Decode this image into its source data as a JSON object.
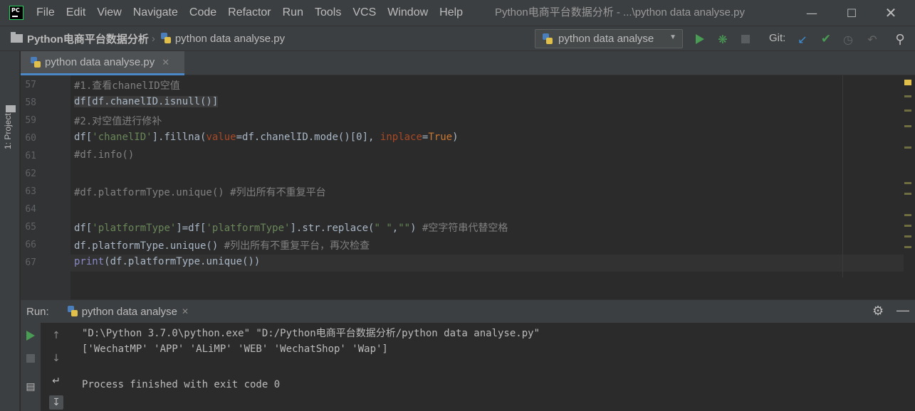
{
  "app": {
    "logo_text": "PC"
  },
  "menu": [
    "File",
    "Edit",
    "View",
    "Navigate",
    "Code",
    "Refactor",
    "Run",
    "Tools",
    "VCS",
    "Window",
    "Help"
  ],
  "window_title": "Python电商平台数据分析 - ...\\python data analyse.py",
  "breadcrumb": {
    "project": "Python电商平台数据分析",
    "file": "python data analyse.py"
  },
  "run_config": {
    "selected": "python data analyse"
  },
  "git_label": "Git:",
  "left_tab": "1: Project",
  "editor_tab": {
    "label": "python data analyse.py"
  },
  "editor": {
    "lines": [
      {
        "n": "57",
        "segs": [
          [
            "cm",
            "#1.查看chanelID空值"
          ]
        ]
      },
      {
        "n": "58",
        "segs": [
          [
            "hl",
            "df[df.chanelID.isnull()]"
          ]
        ]
      },
      {
        "n": "59",
        "segs": [
          [
            "cm",
            "#2.对空值进行修补"
          ]
        ]
      },
      {
        "n": "60",
        "segs": [
          [
            "t",
            "df["
          ],
          [
            "str",
            "'chanelID'"
          ],
          [
            "t",
            "].fillna("
          ],
          [
            "prm",
            "value"
          ],
          [
            "t",
            "=df.chanelID.mode()[0], "
          ],
          [
            "prm",
            "inplace"
          ],
          [
            "t",
            "="
          ],
          [
            "kw",
            "True"
          ],
          [
            "t",
            ")"
          ]
        ]
      },
      {
        "n": "61",
        "segs": [
          [
            "cm",
            "#df.info()"
          ]
        ]
      },
      {
        "n": "62",
        "segs": []
      },
      {
        "n": "63",
        "segs": [
          [
            "cm",
            "#df.platformType.unique() #列出所有不重复平台"
          ]
        ]
      },
      {
        "n": "64",
        "segs": []
      },
      {
        "n": "65",
        "segs": [
          [
            "t",
            "df["
          ],
          [
            "str",
            "'platformType'"
          ],
          [
            "t",
            "]=df["
          ],
          [
            "str",
            "'platformType'"
          ],
          [
            "t",
            "].str.replace("
          ],
          [
            "str",
            "\" \""
          ],
          [
            "t",
            ","
          ],
          [
            "str",
            "\"\""
          ],
          [
            "t",
            ") "
          ],
          [
            "cm",
            "#空字符串代替空格"
          ]
        ]
      },
      {
        "n": "66",
        "segs": [
          [
            "t",
            "df.platformType.unique() "
          ],
          [
            "cm",
            "#列出所有不重复平台，再次检查"
          ]
        ]
      },
      {
        "n": "67",
        "segs": [
          [
            "bi",
            "print"
          ],
          [
            "t",
            "(df.platformType.unique())"
          ]
        ]
      }
    ]
  },
  "run": {
    "label": "Run:",
    "tab": "python data analyse",
    "output": [
      "\"D:\\Python 3.7.0\\python.exe\" \"D:/Python电商平台数据分析/python data analyse.py\"",
      "['WechatMP' 'APP' 'ALiMP' 'WEB' 'WechatShop' 'Wap']",
      "",
      "Process finished with exit code 0"
    ]
  }
}
